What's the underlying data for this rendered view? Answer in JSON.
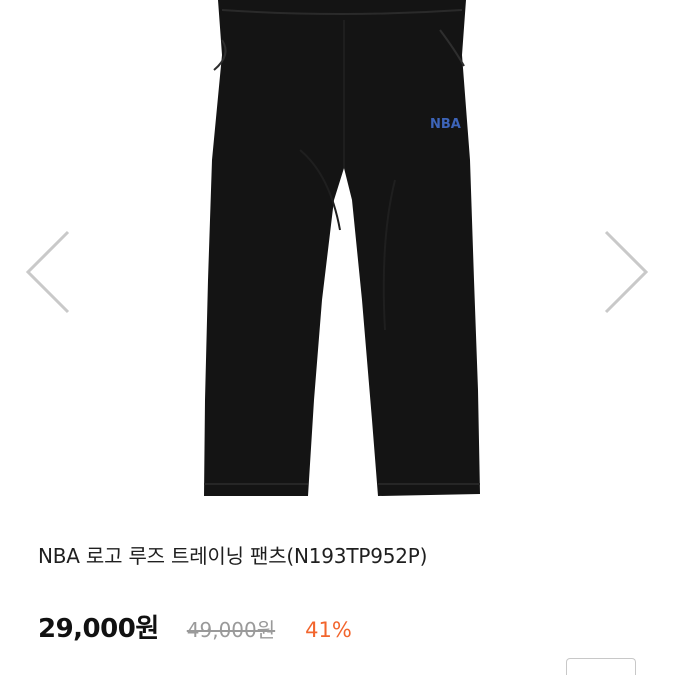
{
  "product": {
    "logo_text": "NBA",
    "title": "NBA 로고 루즈 트레이닝 팬츠(N193TP952P)",
    "price": "29,000원",
    "original_price": "49,000원",
    "discount": "41%"
  },
  "gallery": {
    "prev_icon": "chevron-left-icon",
    "next_icon": "chevron-right-icon"
  },
  "colors": {
    "discount": "#f2652d",
    "logo": "#3d64b8",
    "pants": "#141414"
  }
}
